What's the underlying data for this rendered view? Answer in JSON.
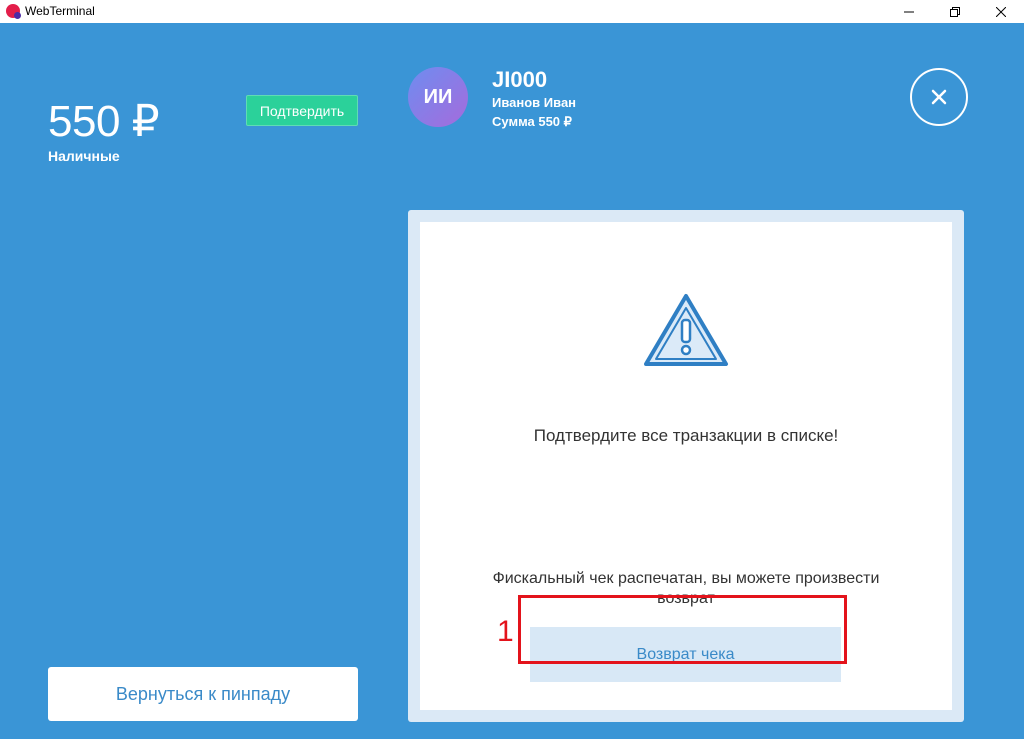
{
  "window": {
    "title": "WebTerminal"
  },
  "payment": {
    "amount": "550 ₽",
    "method": "Наличные",
    "confirm_label": "Подтвердить"
  },
  "user": {
    "initials": "ИИ",
    "code": "JI000",
    "name": "Иванов Иван",
    "sum": "Сумма 550 ₽"
  },
  "panel": {
    "warning_text": "Подтвердите все транзакции в списке!",
    "fiscal_text": "Фискальный чек распечатан, вы можете произвести возврат",
    "refund_label": "Возврат чека"
  },
  "footer": {
    "back_label": "Вернуться к пинпаду"
  },
  "annotation": {
    "number": "1"
  },
  "colors": {
    "background": "#3a95d6",
    "accent_green": "#2bd19a",
    "link_blue": "#3a8ac8",
    "highlight_red": "#e3131b"
  }
}
